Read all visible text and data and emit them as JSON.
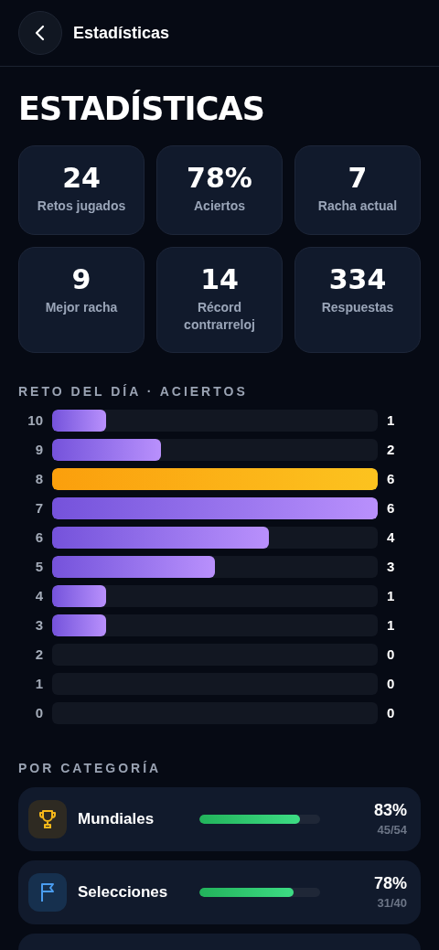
{
  "header": {
    "title": "Estadísticas"
  },
  "page_title": "ESTADÍSTICAS",
  "stats": [
    {
      "value": "24",
      "label": "Retos jugados"
    },
    {
      "value": "78%",
      "label": "Aciertos"
    },
    {
      "value": "7",
      "label": "Racha actual"
    },
    {
      "value": "9",
      "label": "Mejor racha"
    },
    {
      "value": "14",
      "label": "Récord contrarreloj"
    },
    {
      "value": "334",
      "label": "Respuestas"
    }
  ],
  "daily_chart": {
    "title": "RETO DEL DÍA · ACIERTOS",
    "rows": [
      {
        "label": "10",
        "count": "1",
        "selected": false
      },
      {
        "label": "9",
        "count": "2",
        "selected": false
      },
      {
        "label": "8",
        "count": "6",
        "selected": true
      },
      {
        "label": "7",
        "count": "6",
        "selected": false
      },
      {
        "label": "6",
        "count": "4",
        "selected": false
      },
      {
        "label": "5",
        "count": "3",
        "selected": false
      },
      {
        "label": "4",
        "count": "1",
        "selected": false
      },
      {
        "label": "3",
        "count": "1",
        "selected": false
      },
      {
        "label": "2",
        "count": "0",
        "selected": false
      },
      {
        "label": "1",
        "count": "0",
        "selected": false
      },
      {
        "label": "0",
        "count": "0",
        "selected": false
      }
    ]
  },
  "categories": {
    "title": "POR CATEGORÍA",
    "items": [
      {
        "kind": "trophy",
        "name": "Mundiales",
        "level": 0.83,
        "percent": "83%",
        "score": "45/54"
      },
      {
        "kind": "flag",
        "name": "Selecciones",
        "level": 0.78,
        "percent": "78%",
        "score": "31/40"
      },
      {
        "kind": "cut"
      }
    ]
  }
}
